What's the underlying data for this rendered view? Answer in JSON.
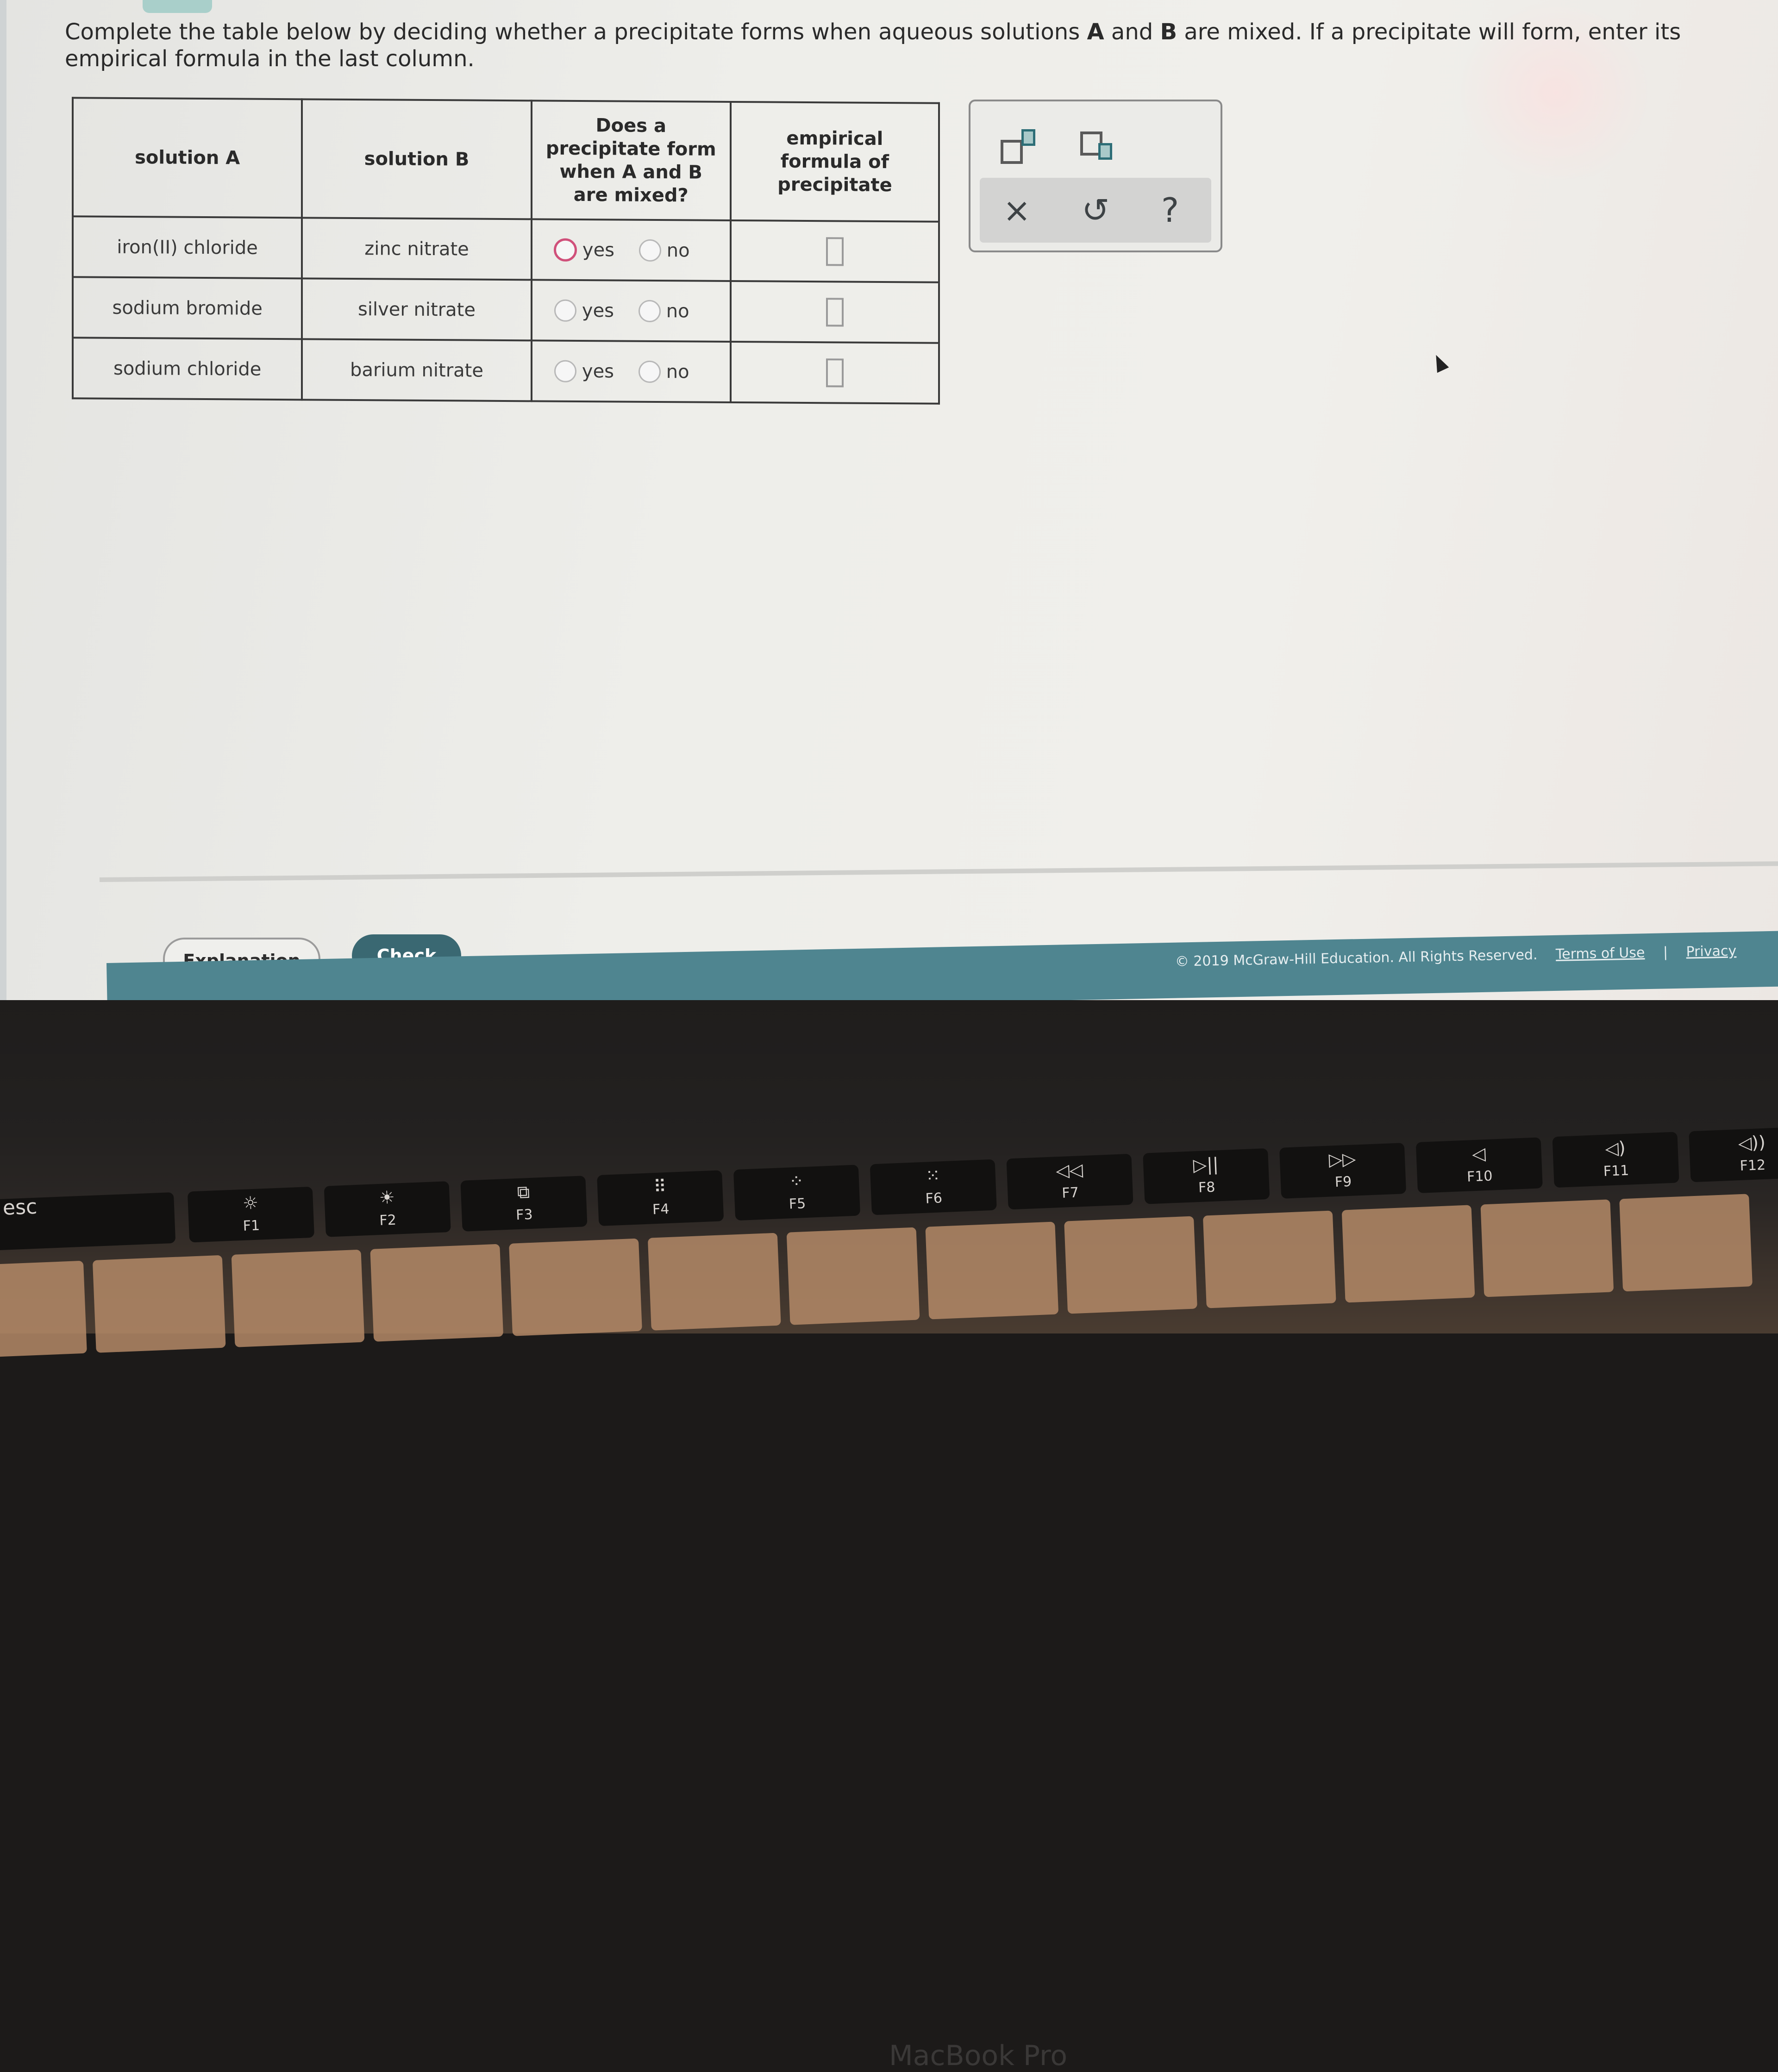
{
  "prompt": {
    "text_before_a": "Complete the table below by deciding whether a precipitate forms when aqueous solutions ",
    "bold_a": "A",
    "text_and": " and ",
    "bold_b": "B",
    "text_after_b": " are mixed. If a precipitate will form, enter its empirical formula in the last column."
  },
  "table": {
    "headers": [
      "solution A",
      "solution B",
      "Does a precipitate form when A and B are mixed?",
      "empirical formula of precipitate"
    ],
    "rows": [
      {
        "solution_a": "iron(II) chloride",
        "solution_b": "zinc nitrate",
        "yes_label": "yes",
        "no_label": "no",
        "selected": null,
        "formula": ""
      },
      {
        "solution_a": "sodium bromide",
        "solution_b": "silver nitrate",
        "yes_label": "yes",
        "no_label": "no",
        "selected": null,
        "formula": ""
      },
      {
        "solution_a": "sodium chloride",
        "solution_b": "barium nitrate",
        "yes_label": "yes",
        "no_label": "no",
        "selected": null,
        "formula": ""
      }
    ]
  },
  "palette": {
    "superscript": "superscript-template",
    "subscript": "subscript-template",
    "clear": "×",
    "undo": "↺",
    "help": "?"
  },
  "buttons": {
    "explanation": "Explanation",
    "check": "Check"
  },
  "footer": {
    "copyright": "© 2019 McGraw-Hill Education. All Rights Reserved.",
    "terms": "Terms of Use",
    "separator": "|",
    "privacy": "Privacy"
  },
  "laptop": {
    "brand": "MacBook Pro",
    "keys": [
      {
        "label": "esc",
        "icon": ""
      },
      {
        "label": "F1",
        "icon": "☼"
      },
      {
        "label": "F2",
        "icon": "☀"
      },
      {
        "label": "F3",
        "icon": "⧉"
      },
      {
        "label": "F4",
        "icon": "⠿"
      },
      {
        "label": "F5",
        "icon": "⁘"
      },
      {
        "label": "F6",
        "icon": "⁙"
      },
      {
        "label": "F7",
        "icon": "◁◁"
      },
      {
        "label": "F8",
        "icon": "▷||"
      },
      {
        "label": "F9",
        "icon": "▷▷"
      },
      {
        "label": "F10",
        "icon": "◁"
      },
      {
        "label": "F11",
        "icon": "◁)"
      },
      {
        "label": "F12",
        "icon": "◁))"
      }
    ]
  },
  "colors": {
    "accent": "#3a6872",
    "footer": "#4f8590",
    "radio_focus": "#d0507a",
    "template_accent": "#2d6e77"
  }
}
